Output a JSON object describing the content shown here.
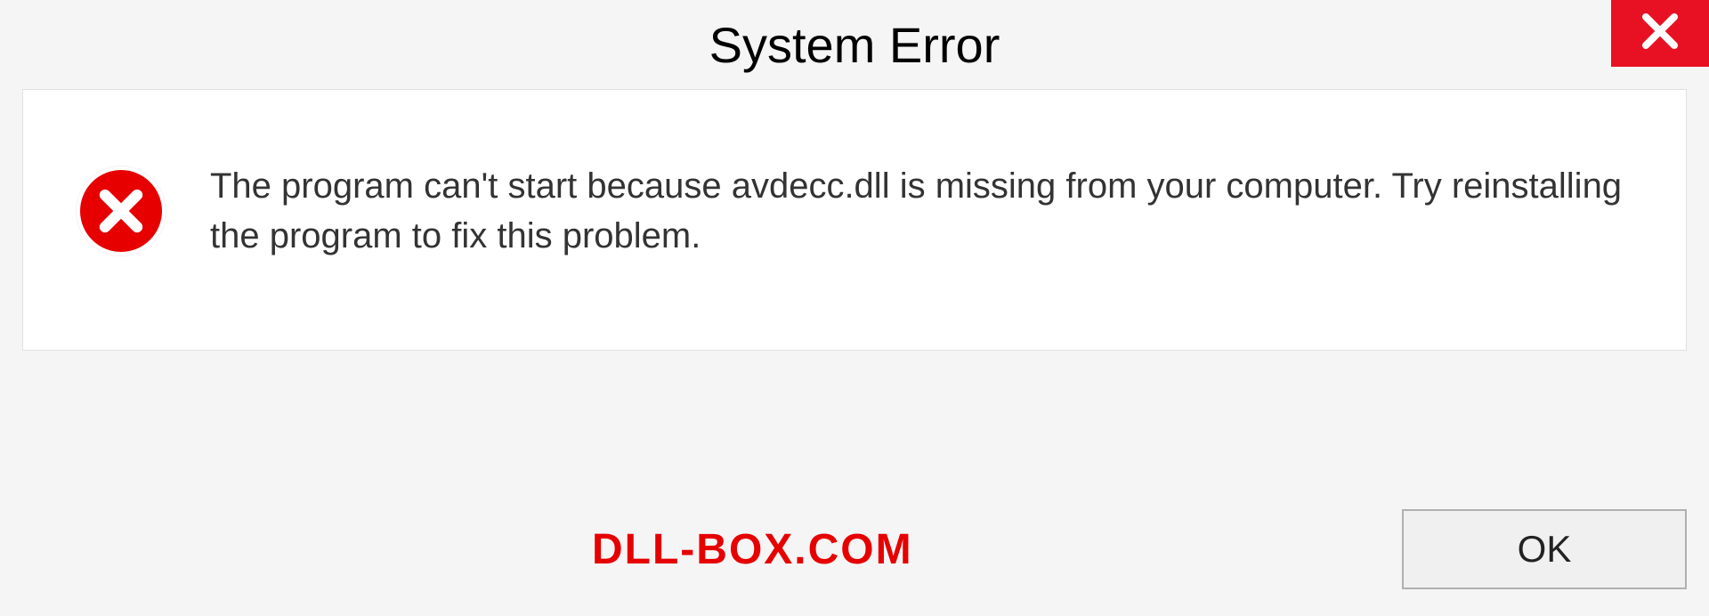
{
  "dialog": {
    "title": "System Error",
    "message": "The program can't start because avdecc.dll is missing from your computer. Try reinstalling the program to fix this problem.",
    "ok_label": "OK",
    "watermark": "DLL-BOX.COM"
  }
}
